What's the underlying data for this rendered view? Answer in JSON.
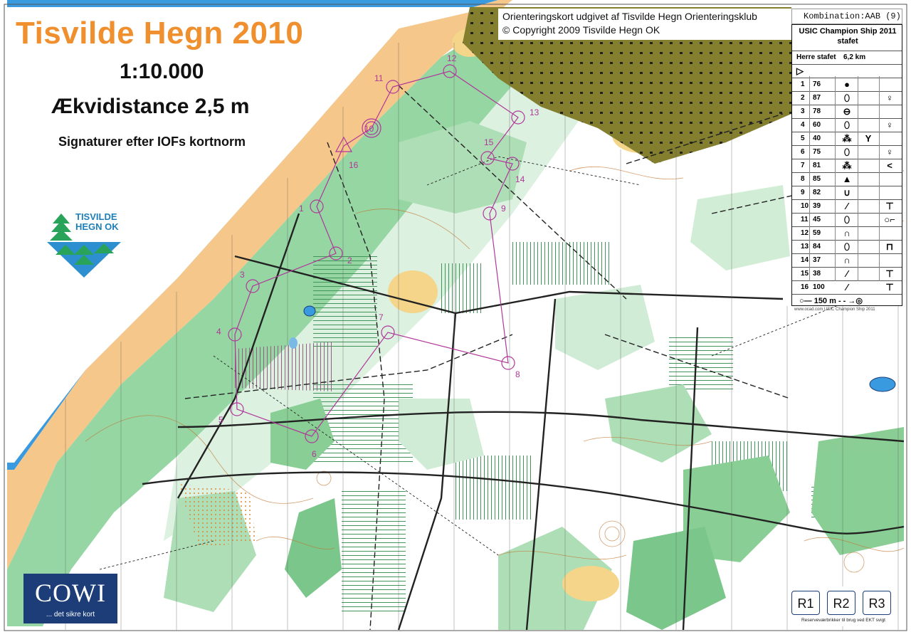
{
  "map": {
    "title": "Tisvilde Hegn 2010",
    "scale": "1:10.000",
    "equidistance": "Ækvidistance 2,5 m",
    "symbols_note": "Signaturer efter IOFs kortnorm",
    "club_logo": {
      "line1": "TISVILDE",
      "line2": "HEGN OK"
    },
    "publisher_line": "Orienteringskort udgivet af Tisvilde Hegn Orienteringsklub",
    "copyright_line": "© Copyright 2009 Tisvilde Hegn OK",
    "combination": "Kombination:AAB (9)",
    "sponsor": {
      "name": "COWI",
      "tagline": "... det sikre kort"
    },
    "colors": {
      "sea": "#3a9ae0",
      "sand": "#f5c78a",
      "forest_green": "#7dc98a",
      "olive_settlement": "#7b7a2a",
      "course_purple": "#b0379a",
      "title_orange": "#ef8f2e"
    }
  },
  "course": {
    "event": "USIC Champion Ship 2011",
    "type": "stafet",
    "class": "Herre stafet",
    "length": "6,2 km",
    "start_symbol": "▷",
    "controls": [
      {
        "num": "1",
        "code": "76",
        "feature": "●",
        "detail": ""
      },
      {
        "num": "2",
        "code": "87",
        "feature": "⬯",
        "detail": "♀"
      },
      {
        "num": "3",
        "code": "78",
        "feature": "⊖",
        "detail": ""
      },
      {
        "num": "4",
        "code": "60",
        "feature": "⬯",
        "detail": "♀"
      },
      {
        "num": "5",
        "code": "40",
        "feature": "⁂",
        "extra": "Y",
        "detail": ""
      },
      {
        "num": "6",
        "code": "75",
        "feature": "⬯",
        "detail": "♀"
      },
      {
        "num": "7",
        "code": "81",
        "feature": "⁂",
        "detail": "<"
      },
      {
        "num": "8",
        "code": "85",
        "feature": "▲",
        "detail": ""
      },
      {
        "num": "9",
        "code": "82",
        "feature": "∪",
        "detail": ""
      },
      {
        "num": "10",
        "code": "39",
        "feature": "⁄",
        "detail": "⊤"
      },
      {
        "num": "11",
        "code": "45",
        "feature": "⬯",
        "detail": "○⌐"
      },
      {
        "num": "12",
        "code": "59",
        "feature": "∩",
        "detail": ""
      },
      {
        "num": "13",
        "code": "84",
        "feature": "⬯",
        "detail": "⊓"
      },
      {
        "num": "14",
        "code": "37",
        "feature": "∩",
        "detail": ""
      },
      {
        "num": "15",
        "code": "38",
        "feature": "⁄",
        "detail": "⊤"
      },
      {
        "num": "16",
        "code": "100",
        "feature": "⁄",
        "detail": "⊤"
      }
    ],
    "finish_line": "○— 150 m - - →◎",
    "footnote": "www.ocad.com USIC Champion Ship 2011"
  },
  "rescue": {
    "buttons": [
      "R1",
      "R2",
      "R3"
    ],
    "note": "Reserveværbrikker til brug ved EKT svigt"
  },
  "control_labels": [
    "1",
    "2",
    "3",
    "4",
    "5",
    "6",
    "7",
    "8",
    "9",
    "10",
    "11",
    "12",
    "13",
    "14",
    "15",
    "16"
  ]
}
